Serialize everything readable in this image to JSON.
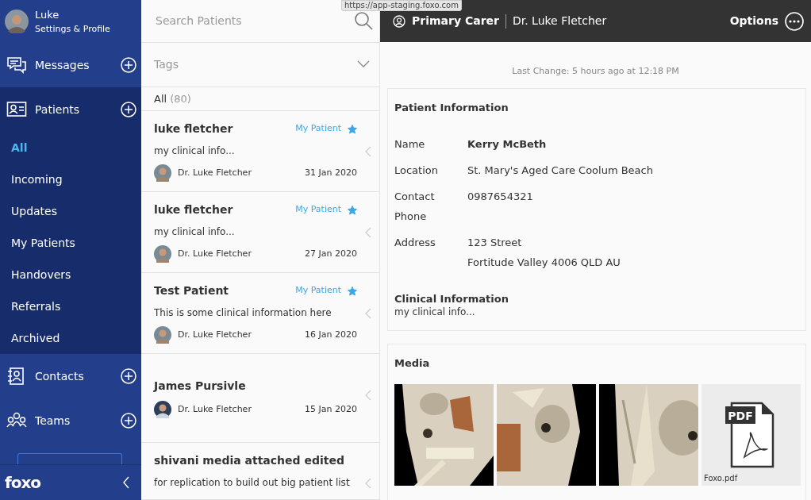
{
  "tooltip": "https://app-staging.foxo.com",
  "user": {
    "name": "Luke",
    "subtitle": "Settings & Profile"
  },
  "sidebar": {
    "sections": [
      {
        "kind": "messages",
        "label": "Messages",
        "expanded": false
      },
      {
        "kind": "patients",
        "label": "Patients",
        "expanded": true,
        "items": [
          {
            "label": "All",
            "selected": true
          },
          {
            "label": "Incoming",
            "selected": false
          },
          {
            "label": "Updates",
            "selected": false
          },
          {
            "label": "My Patients",
            "selected": false
          },
          {
            "label": "Handovers",
            "selected": false
          },
          {
            "label": "Referrals",
            "selected": false
          },
          {
            "label": "Archived",
            "selected": false
          }
        ]
      },
      {
        "kind": "contacts",
        "label": "Contacts",
        "expanded": false
      },
      {
        "kind": "teams",
        "label": "Teams",
        "expanded": false
      }
    ],
    "logo": "foxo"
  },
  "patient_list": {
    "search_placeholder": "Search Patients",
    "tags_label": "Tags",
    "filter": "All",
    "count": "(80)",
    "patients": [
      {
        "name": "luke fletcher",
        "tag": "My Patient",
        "starred": true,
        "info": "my clinical info...",
        "doctor": "Dr. Luke Fletcher",
        "date": "31 Jan 2020"
      },
      {
        "name": "luke fletcher",
        "tag": "My Patient",
        "starred": true,
        "info": "my clinical info...",
        "doctor": "Dr. Luke Fletcher",
        "date": "27 Jan 2020"
      },
      {
        "name": "Test Patient",
        "tag": "My Patient",
        "starred": true,
        "info": "This is some clinical information here",
        "doctor": "Dr. Luke Fletcher",
        "date": "16 Jan 2020"
      },
      {
        "name": "James Pursivle",
        "doctor": "Dr. Luke Fletcher",
        "date": "15 Jan 2020"
      },
      {
        "name": "shivani media attached edited",
        "info": "for replication to build out big patient list"
      }
    ]
  },
  "header": {
    "role": "Primary Carer",
    "carer": "Dr. Luke Fletcher",
    "options": "Options"
  },
  "last_change": "Last Change: 5 hours ago at 12:18 PM",
  "patient_information": {
    "title": "Patient Information",
    "fields": [
      {
        "label": "Name",
        "lines": [
          "Kerry McBeth"
        ],
        "bold": true
      },
      {
        "label": "Location",
        "lines": [
          "St. Mary's Aged Care Coolum Beach"
        ]
      },
      {
        "label": "Contact Phone",
        "lines": [
          "0987654321"
        ]
      },
      {
        "label": "Address",
        "lines": [
          "123 Street",
          "Fortitude Valley 4006 QLD AU"
        ]
      }
    ],
    "clinical_title": "Clinical Information",
    "clinical_text": "my clinical info..."
  },
  "media": {
    "title": "Media",
    "items": [
      {
        "kind": "picture"
      },
      {
        "kind": "picture"
      },
      {
        "kind": "picture"
      },
      {
        "kind": "pdf",
        "label": "PDF",
        "filename": "Foxo.pdf"
      }
    ]
  }
}
